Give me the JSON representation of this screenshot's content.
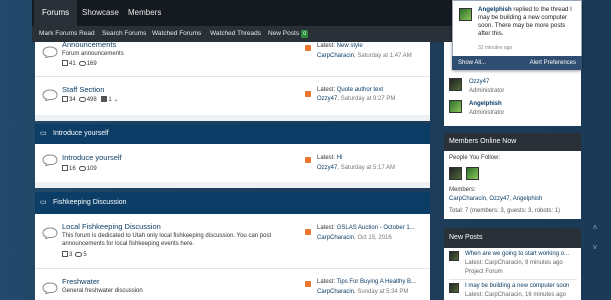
{
  "nav": {
    "tabs": [
      {
        "label": "Forums",
        "active": true
      },
      {
        "label": "Showcase",
        "active": false
      },
      {
        "label": "Members",
        "active": false
      }
    ],
    "sub_links": [
      "Mark Forums Read",
      "Search Forums",
      "Watched Forums",
      "Watched Threads",
      "New Posts"
    ],
    "new_posts_count": "0"
  },
  "forums": [
    {
      "title": "Announcements",
      "desc": "Forum announcements",
      "threads": "41",
      "messages": "169",
      "latest_prefix": "Latest:",
      "latest_title": "New style",
      "author": "CarpCharacin",
      "when": "Saturday at 1:47 AM"
    },
    {
      "title": "Staff Section",
      "desc": "",
      "threads": "34",
      "messages": "498",
      "subforums": "1",
      "latest_prefix": "Latest:",
      "latest_title": "Quote author text",
      "author": "Ozzy47",
      "when": "Saturday at 9:27 PM"
    },
    {
      "title": "Introduce yourself",
      "desc": "",
      "threads": "16",
      "messages": "109",
      "latest_prefix": "Latest:",
      "latest_title": "Hi",
      "author": "Ozzy47",
      "when": "Saturday at 5:17 AM"
    },
    {
      "title": "Local Fishkeeping Discussion",
      "desc": "This forum is dedicated to Utah only local fishkeeping discussion. You can post announcements for local fishkeeping events here.",
      "threads": "3",
      "messages": "5",
      "latest_prefix": "Latest:",
      "latest_title": "GSLAS Auction - October 1...",
      "author": "CarpCharacin",
      "when": "Oct 15, 2016"
    },
    {
      "title": "Freshwater",
      "desc": "General freshwater discussion",
      "threads": "",
      "messages": "",
      "latest_prefix": "Latest:",
      "latest_title": "Tips For Buying A Healthy B...",
      "author": "CarpCharacin",
      "when": "Sunday at 5:34 PM"
    }
  ],
  "categories": [
    "Introduce yourself",
    "Fishkeeping Discussion"
  ],
  "alert": {
    "user": "Angelphish",
    "text": "replied to the thread I may be building a new computer soon. There may be more posts after this.",
    "time": "32 minutes ago",
    "show_all": "Show All...",
    "prefs": "Alert Preferences"
  },
  "staff": [
    {
      "name": "Ozzy47",
      "role": "Administrator"
    },
    {
      "name": "Angelphish",
      "role": "Administrator"
    }
  ],
  "members_online": {
    "title": "Members Online Now",
    "people_you_follow": "People You Follow:",
    "members_label": "Members:",
    "members_list": "CarpCharacin, Ozzy47, Angelphish",
    "total": "Total: 7 (members: 3, guests: 3, robots: 1)"
  },
  "new_posts": {
    "title": "New Posts",
    "items": [
      {
        "title": "When are we going to start working o...",
        "meta": "Latest: CarpCharacin, 9 minutes ago",
        "forum": "Project Forum"
      },
      {
        "title": "I may be building a new computer soon",
        "meta": "Latest: CarpCharacin, 16 minutes ago",
        "forum": ""
      }
    ]
  }
}
